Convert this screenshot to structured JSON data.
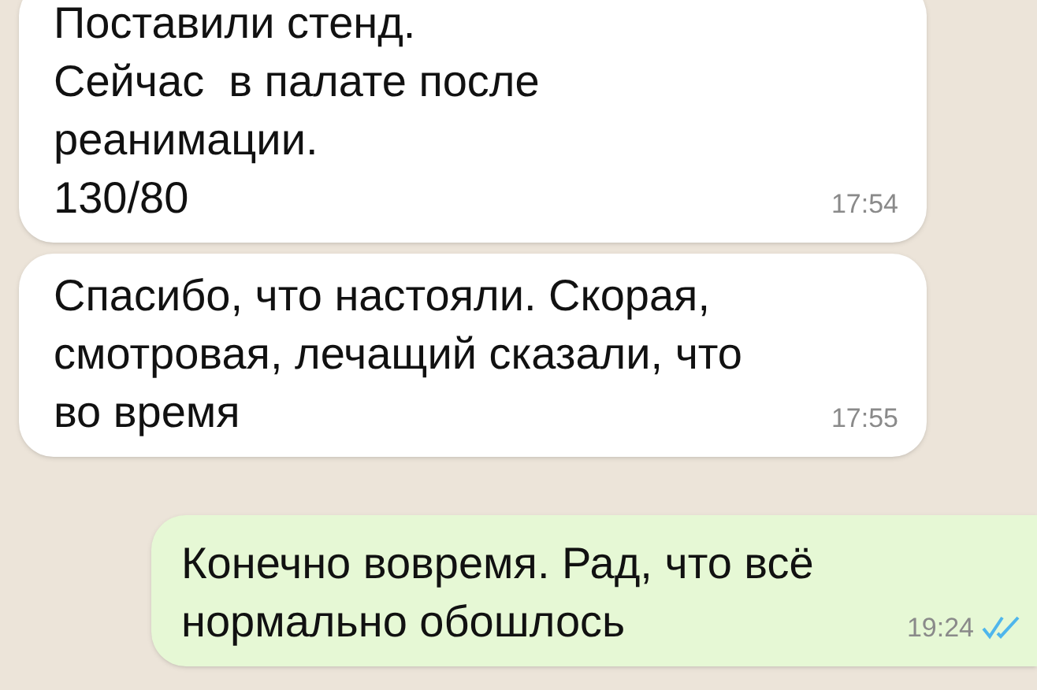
{
  "messages": [
    {
      "outgoing": false,
      "text": "Поставили стенд.\nСейчас  в палате после\nреанимации.\n130/80",
      "time": "17:54"
    },
    {
      "outgoing": false,
      "text": "Спасибо, что настояли. Скорая, смотровая, лечащий сказали, что во время",
      "time": "17:55"
    },
    {
      "outgoing": true,
      "text": "Конечно вовремя. Рад, что всё нормально обошлось",
      "time": "19:24",
      "read": true
    }
  ]
}
